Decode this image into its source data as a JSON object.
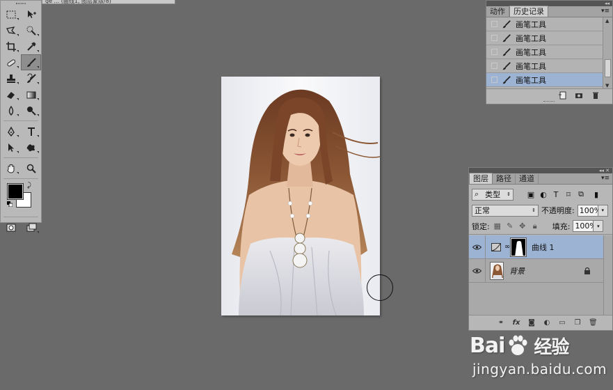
{
  "doc_tab_fragment": "ge ... (曲线1, 图层蒙版/8)",
  "toolbox": {
    "tools": [
      [
        "marquee-icon",
        "move-icon"
      ],
      [
        "lasso-icon",
        "quick-select-icon"
      ],
      [
        "crop-icon",
        "eyedropper-icon"
      ],
      [
        "healing-icon",
        "brush-icon"
      ],
      [
        "clone-stamp-icon",
        "history-brush-icon"
      ],
      [
        "eraser-icon",
        "gradient-icon"
      ],
      [
        "blur-icon",
        "dodge-icon"
      ],
      [
        "pen-icon",
        "type-icon"
      ],
      [
        "path-select-icon",
        "shape-icon"
      ],
      [
        "hand-icon",
        "zoom-icon"
      ]
    ],
    "active_tool": "brush-icon",
    "foreground_color": "#000000",
    "background_color": "#ffffff"
  },
  "history_panel": {
    "tabs": [
      "动作",
      "历史记录"
    ],
    "active_tab": "历史记录",
    "items": [
      {
        "label": "画笔工具",
        "icon": "brush-icon",
        "selected": false
      },
      {
        "label": "画笔工具",
        "icon": "brush-icon",
        "selected": false
      },
      {
        "label": "画笔工具",
        "icon": "brush-icon",
        "selected": false
      },
      {
        "label": "画笔工具",
        "icon": "brush-icon",
        "selected": false
      },
      {
        "label": "画笔工具",
        "icon": "brush-icon",
        "selected": true
      }
    ],
    "footer_icons": [
      "new-document-from-state-icon",
      "camera-icon",
      "trash-icon"
    ]
  },
  "layers_panel": {
    "tabs": [
      "图层",
      "路径",
      "通道"
    ],
    "active_tab": "图层",
    "filter_label": "类型",
    "blend_mode": "正常",
    "opacity_label": "不透明度:",
    "opacity_value": "100%",
    "lock_label": "锁定:",
    "fill_label": "填充:",
    "fill_value": "100%",
    "layers": [
      {
        "name": "曲线 1",
        "type": "adjustment-curves",
        "visible": true,
        "selected": true,
        "locked": false
      },
      {
        "name": "背景",
        "type": "image",
        "visible": true,
        "selected": false,
        "locked": true
      }
    ],
    "footer_icons": [
      "link-icon",
      "fx-icon",
      "add-mask-icon",
      "adjustment-icon",
      "folder-icon",
      "new-layer-icon",
      "trash-icon"
    ],
    "footer_fx_label": "fx"
  },
  "watermark": {
    "logo_left": "Bai",
    "logo_right": "经验",
    "url": "jingyan.baidu.com"
  }
}
